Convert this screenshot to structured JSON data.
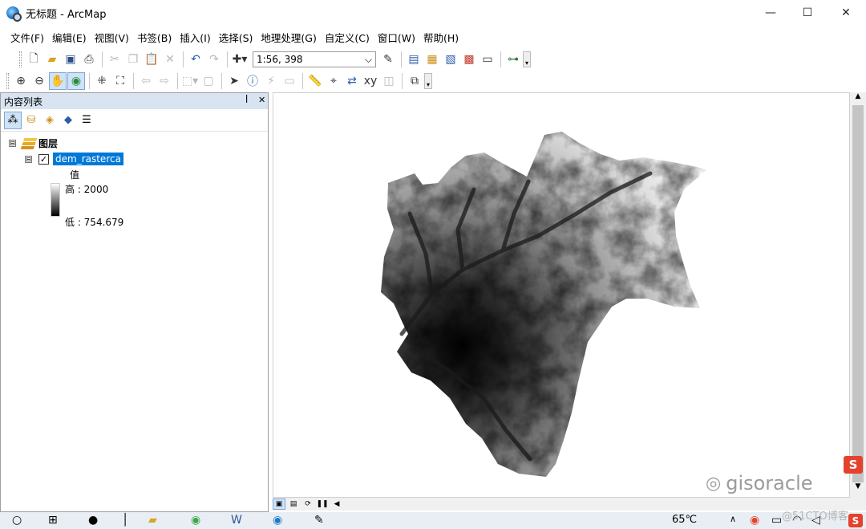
{
  "window": {
    "title": "无标题 - ArcMap",
    "minimize": "—",
    "maximize": "☐",
    "close": "✕"
  },
  "menu": [
    "文件(F)",
    "编辑(E)",
    "视图(V)",
    "书签(B)",
    "插入(I)",
    "选择(S)",
    "地理处理(G)",
    "自定义(C)",
    "窗口(W)",
    "帮助(H)"
  ],
  "toolbar": {
    "scale_value": "1:56, 398",
    "scale_arrow": "⌵"
  },
  "toc": {
    "title": "内容列表",
    "pin": "ꟾ",
    "close": "✕",
    "layers_root": "图层",
    "layer_name": "dem_rasterca",
    "legend_title": "值",
    "legend_high": "高 : 2000",
    "legend_low": "低 : 754.679",
    "expander": "⊟",
    "check": "✓"
  },
  "map_layer": {
    "colors": {
      "high": "#ffffff",
      "low": "#000000"
    }
  },
  "taskbar": {
    "temperature": "65℃"
  },
  "watermark": {
    "brand": "gisoracle",
    "site": "@51CTO博客",
    "sogou": "S"
  }
}
